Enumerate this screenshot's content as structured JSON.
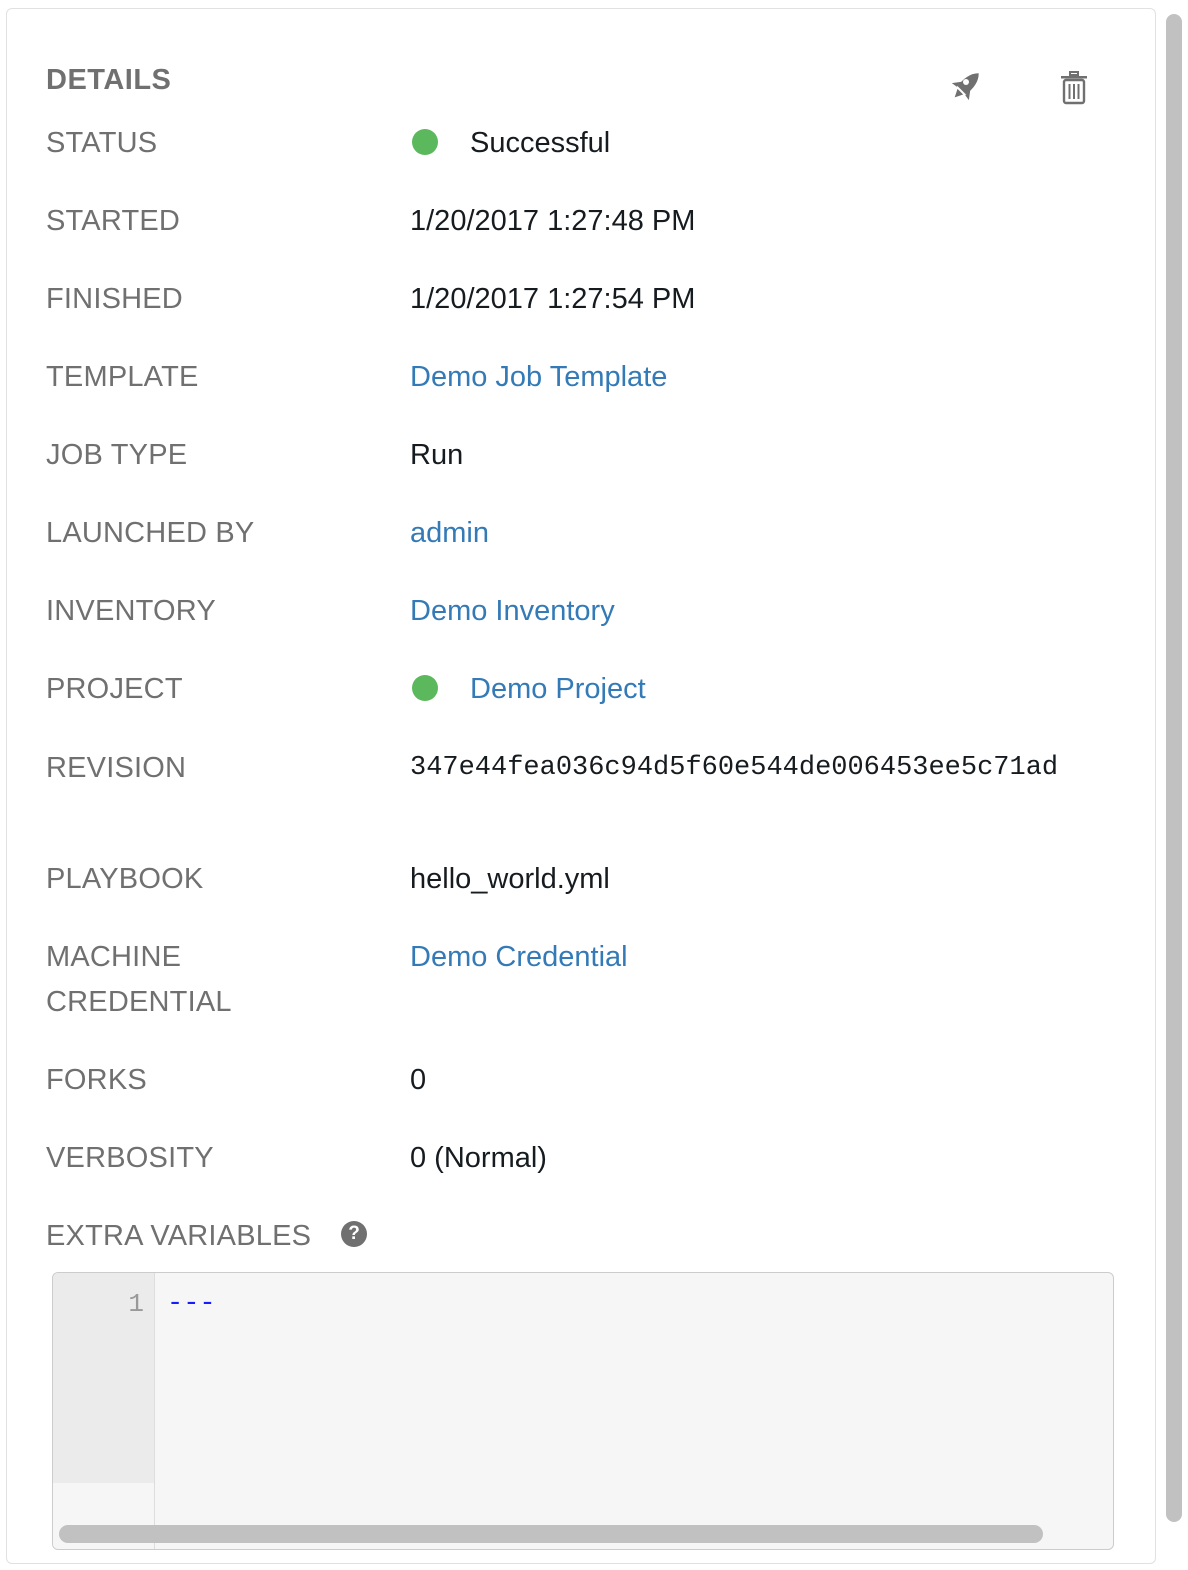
{
  "details": {
    "title": "DETAILS",
    "actions": {
      "launch_icon": "rocket-icon",
      "delete_icon": "trash-icon"
    },
    "status": {
      "label": "STATUS",
      "value": "Successful",
      "color": "#5cb85c"
    },
    "started": {
      "label": "STARTED",
      "value": "1/20/2017 1:27:48 PM"
    },
    "finished": {
      "label": "FINISHED",
      "value": "1/20/2017 1:27:54 PM"
    },
    "template": {
      "label": "TEMPLATE",
      "value": "Demo Job Template"
    },
    "job_type": {
      "label": "JOB TYPE",
      "value": "Run"
    },
    "launched_by": {
      "label": "LAUNCHED BY",
      "value": "admin"
    },
    "inventory": {
      "label": "INVENTORY",
      "value": "Demo Inventory"
    },
    "project": {
      "label": "PROJECT",
      "value": "Demo Project",
      "status_color": "#5cb85c"
    },
    "revision": {
      "label": "REVISION",
      "value": "347e44fea036c94d5f60e544de006453ee5c71ad"
    },
    "playbook": {
      "label": "PLAYBOOK",
      "value": "hello_world.yml"
    },
    "machine_credential": {
      "label_line1": "MACHINE",
      "label_line2": "CREDENTIAL",
      "value": "Demo Credential"
    },
    "forks": {
      "label": "FORKS",
      "value": "0"
    },
    "verbosity": {
      "label": "VERBOSITY",
      "value": "0 (Normal)"
    },
    "extra_variables": {
      "label": "EXTRA VARIABLES",
      "help_icon": "?",
      "line_number": "1",
      "code": "---"
    }
  },
  "colors": {
    "link": "#337ab7",
    "label": "#707070",
    "success": "#5cb85c"
  }
}
